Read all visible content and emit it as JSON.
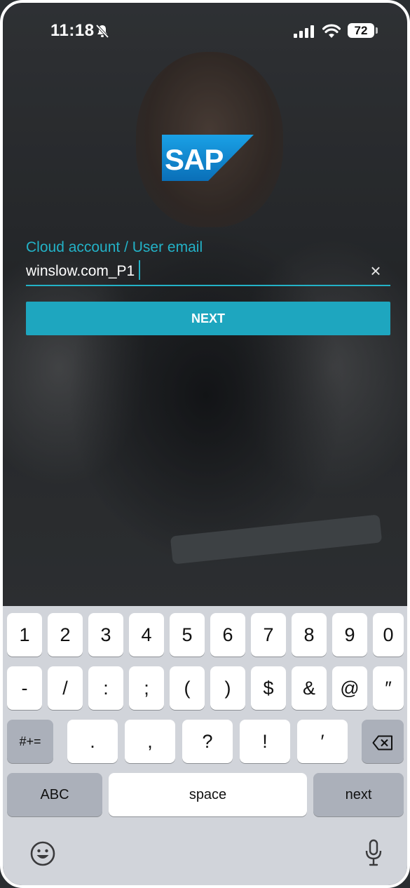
{
  "status_bar": {
    "time": "11:18",
    "battery": "72",
    "icons": [
      "bell-slash-icon",
      "signal-icon",
      "wifi-icon",
      "battery-icon"
    ]
  },
  "logo": {
    "text": "SAP",
    "color": "#0a7ec2"
  },
  "login": {
    "field_label": "Cloud account / User email",
    "field_value": "winslow.com_P1",
    "clear_icon": "×",
    "next_label": "NEXT",
    "accent_color": "#23b2c7"
  },
  "keyboard": {
    "row1": [
      "1",
      "2",
      "3",
      "4",
      "5",
      "6",
      "7",
      "8",
      "9",
      "0"
    ],
    "row2": [
      "-",
      "/",
      ":",
      ";",
      "(",
      ")",
      "$",
      "&",
      "@",
      "″"
    ],
    "row3": [
      "#+=",
      ".",
      ",",
      "?",
      "!",
      "′",
      "⌫"
    ],
    "row4": [
      "ABC",
      "space",
      "next"
    ]
  }
}
